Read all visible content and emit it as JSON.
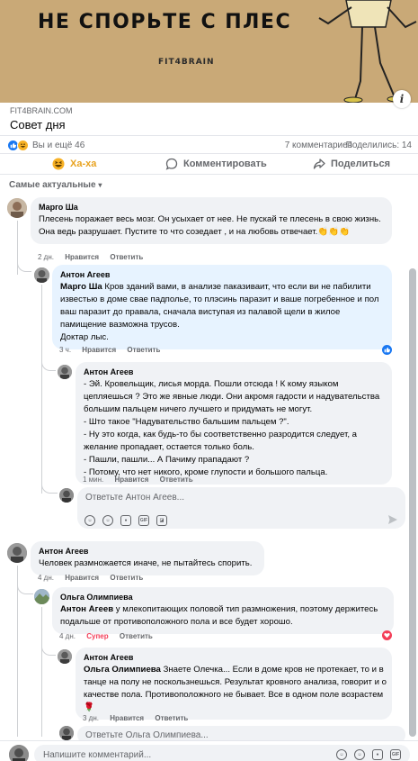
{
  "post": {
    "banner_title": "НЕ СПОРЬТЕ С ПЛЕСЕНЬЮ.",
    "banner_brand": "FIT4BRAIN",
    "link_source": "FIT4BRAIN.COM",
    "link_title": "Совет дня",
    "reactions_text": "Вы и ещё 46",
    "comments_count": "7 комментариев",
    "shares_count": "Поделились: 14"
  },
  "actions": {
    "laugh": "Ха-ха",
    "comment": "Комментировать",
    "share": "Поделиться"
  },
  "sort_label": "Самые актуальные",
  "comments": [
    {
      "author": "Марго Ша",
      "text": "Плесень поражает весь мозг. Он усыхает от нее. Не пускай те плесень в свою жизнь. Она ведь разрушает. Пустите то что созедает , и на любовь отвечает.👏👏👏",
      "time": "2 дн.",
      "like": "Нравится",
      "reply": "Ответить"
    },
    {
      "author": "Антон Агеев",
      "mention": "Марго Ша",
      "text": "Кров зданий вами, в анализе паказиваит, что если ви не пабилити известью в доме сваe падполье, то плэсинь паразит и ваше погребенное и пол ваш паразит до правала, сначала виступая из палавой щели в жилое памищение вазможна трусов.",
      "text2": "Доктар лыс.",
      "time": "3 ч.",
      "like": "Нравится",
      "reply": "Ответить"
    },
    {
      "author": "Антон Агеев",
      "lines": [
        "- Эй. Кровельщик, лисья морда. Пошли отсюда ! К кому языком цепляешься ? Это же явные люди. Они акромя гадости и надувательства большим пальцем ничего лучшего и придумать не могут.",
        "- Што такое \"Надувательство бальшим пальцем ?\".",
        "- Ну это когда, как будь-то бы соответственно разродится следует, а желание пропадает, остается только боль.",
        "- Пашли, пашли... А Пачиму прападают ?",
        "- Потому, что нет никого, кроме глупости и большого пальца."
      ],
      "time": "1 мин.",
      "like": "Нравится",
      "reply": "Ответить"
    },
    {
      "author": "Антон Агеев",
      "text": "Человек размножается иначе, не пытайтесь спорить.",
      "time": "4 дн.",
      "like": "Нравится",
      "reply": "Ответить"
    },
    {
      "author": "Ольга Олимпиева",
      "mention": "Антон Агеев",
      "text": "у млекопитающих половой тип размножения, поэтому держитесь подальше от противоположного пола и все будет хорошо.",
      "time": "4 дн.",
      "like": "Супер",
      "reply": "Ответить"
    },
    {
      "author": "Антон Агеев",
      "mention": "Ольга Олимпиева",
      "text": "Знаете Олечка... Если в доме кров не протекает, то и в танце на полу не поскользнешься. Результат кровного анализа, говорит и о качестве пола. Противоположного не бывает. Все в одном поле возрастем 🌹",
      "time": "3 дн.",
      "like": "Нравится",
      "reply": "Ответить"
    }
  ],
  "reply_boxes": {
    "reply_anton": "Ответьте Антон Агеев...",
    "reply_olga": "Ответьте Ольга Олимпиева..."
  },
  "bottom": {
    "placeholder": "Напишите комментарий..."
  },
  "icons": {
    "like": "like-icon",
    "haha": "haha-icon",
    "comment": "comment-icon",
    "share": "share-icon",
    "info": "info-icon",
    "send": "send-icon"
  },
  "colors": {
    "like_blue": "#1877f2",
    "haha_yellow": "#f7b125",
    "super_red": "#f33e58"
  }
}
